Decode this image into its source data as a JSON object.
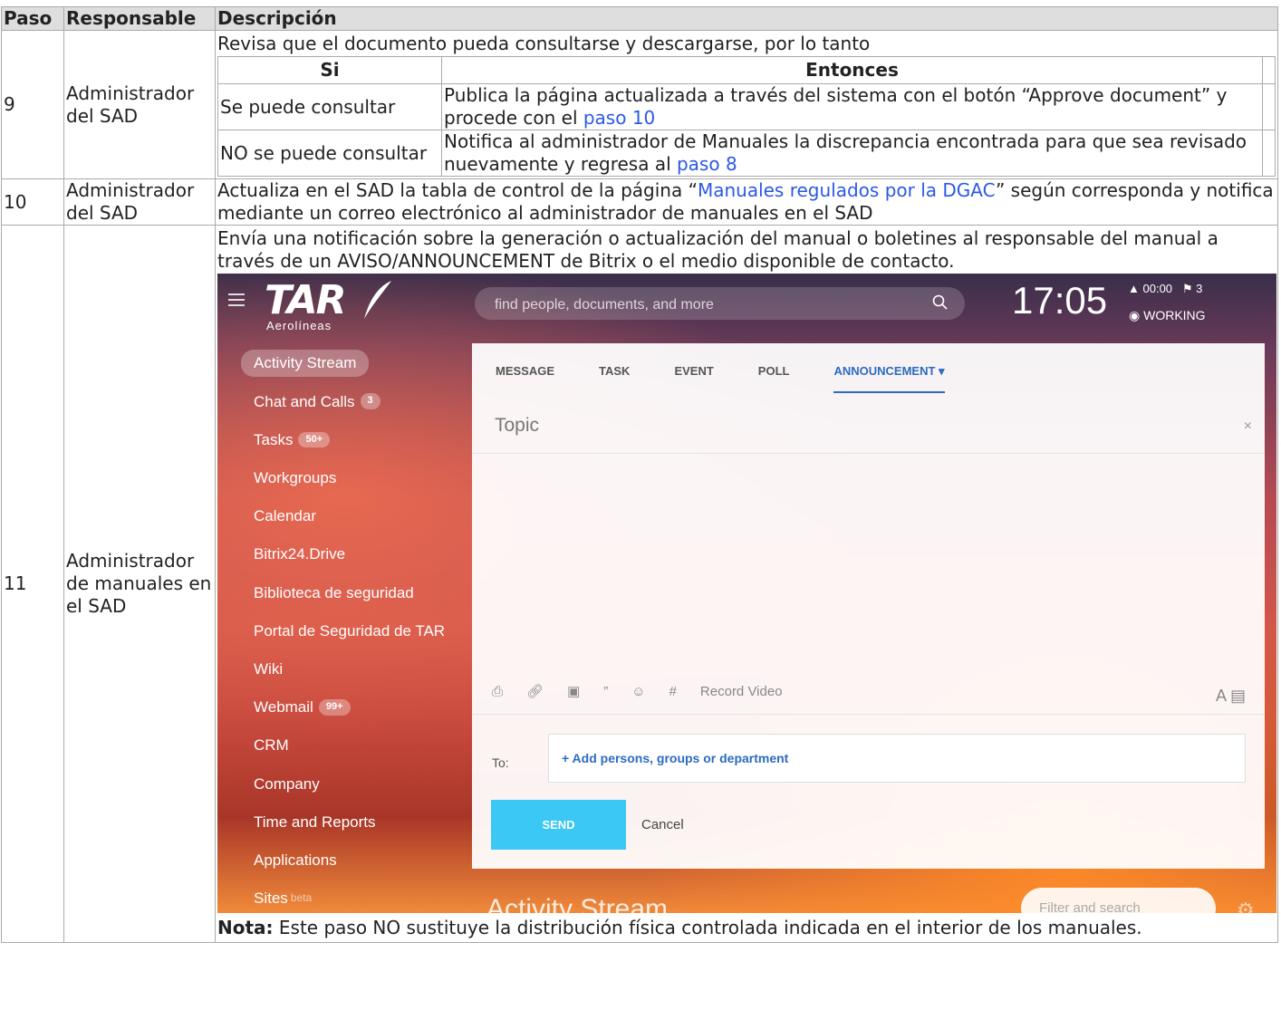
{
  "headers": {
    "paso": "Paso",
    "responsable": "Responsable",
    "descripcion": "Descripción"
  },
  "row9": {
    "paso": "9",
    "responsable": "Administrador del SAD",
    "intro": "Revisa que el documento pueda consultarse y descargarse, por lo tanto",
    "inner_headers": {
      "si": "Si",
      "entonces": "Entonces"
    },
    "r1": {
      "si": "Se puede consultar",
      "entonces_text": "Publica la página actualizada a través del sistema con el botón “Approve document” y procede con el ",
      "link": "paso 10"
    },
    "r2": {
      "si": "NO se puede consultar",
      "entonces_text": "Notifica al administrador de Manuales la discrepancia encontrada para que sea revisado nuevamente y regresa al ",
      "link": "paso 8"
    }
  },
  "row10": {
    "paso": "10",
    "responsable": "Administrador del SAD",
    "text_before": "Actualiza en el SAD la tabla de control de la página “",
    "link": "Manuales regulados por la DGAC",
    "text_after": "” según corresponda y notifica mediante un correo electrónico al administrador de manuales en el SAD"
  },
  "row11": {
    "paso": "11",
    "responsable": "Administrador de manuales en el SAD",
    "intro": "Envía una notificación sobre la generación o actualización del manual o boletines al responsable del manual a través de un AVISO/ANNOUNCEMENT de Bitrix o el medio disponible de contacto.",
    "note_label": "Nota:",
    "note_text": " Este paso NO sustituye la distribución física controlada indicada en el interior de los manuales."
  },
  "screenshot": {
    "logo": "TAR",
    "logo_sub": "Aerolíneas",
    "search_placeholder": "find people, documents, and more",
    "clock": "17:05",
    "timer": "00:00",
    "flags": "3",
    "status": "WORKING",
    "nav": [
      {
        "label": "Activity Stream",
        "badge": ""
      },
      {
        "label": "Chat and Calls",
        "badge": "3"
      },
      {
        "label": "Tasks",
        "badge": "50+"
      },
      {
        "label": "Workgroups",
        "badge": ""
      },
      {
        "label": "Calendar",
        "badge": ""
      },
      {
        "label": "Bitrix24.Drive",
        "badge": ""
      },
      {
        "label": "Biblioteca de seguridad",
        "badge": ""
      },
      {
        "label": "Portal de Seguridad de TAR",
        "badge": ""
      },
      {
        "label": "Wiki",
        "badge": ""
      },
      {
        "label": "Webmail",
        "badge": "99+"
      },
      {
        "label": "CRM",
        "badge": ""
      },
      {
        "label": "Company",
        "badge": ""
      },
      {
        "label": "Time and Reports",
        "badge": ""
      },
      {
        "label": "Applications",
        "badge": ""
      },
      {
        "label": "Sites",
        "badge": ""
      }
    ],
    "sites_beta": "beta",
    "tabs": [
      "MESSAGE",
      "TASK",
      "EVENT",
      "POLL",
      "ANNOUNCEMENT"
    ],
    "topic_placeholder": "Topic",
    "close": "×",
    "record_video": "Record Video",
    "to_label": "To:",
    "add_persons": "+ Add persons, groups or department",
    "send": "SEND",
    "cancel": "Cancel",
    "activity_stream_title": "Activity Stream",
    "filter_placeholder": "Filter and search"
  }
}
